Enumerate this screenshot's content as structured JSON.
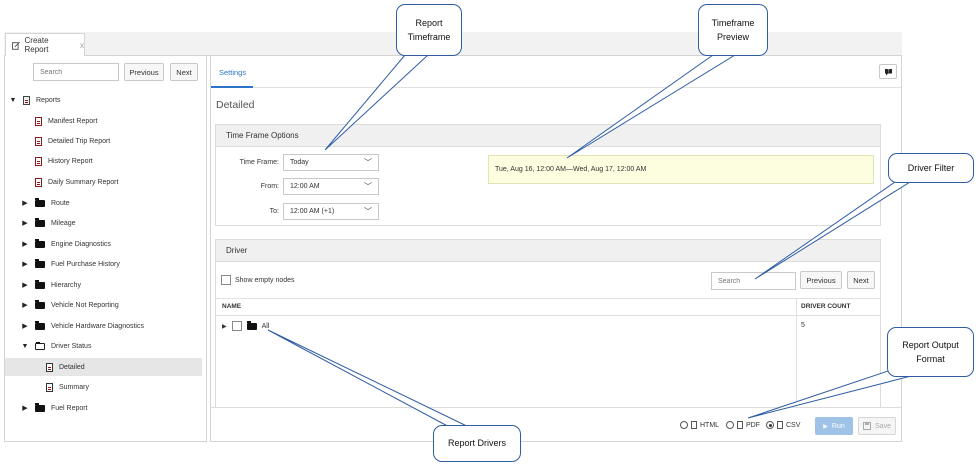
{
  "tab": {
    "label": "Create Report",
    "close": "x"
  },
  "left": {
    "search_placeholder": "Search",
    "previous": "Previous",
    "next": "Next",
    "tree": {
      "root": "Reports",
      "reports": [
        "Manifest Report",
        "Detailed Trip Report",
        "History Report",
        "Daily Summary Report"
      ],
      "folders": [
        "Route",
        "Mileage",
        "Engine Diagnostics",
        "Fuel Purchase History",
        "Hierarchy",
        "Vehicle Not Reporting",
        "Vehicle Hardware Diagnostics"
      ],
      "open_folder": "Driver Status",
      "open_children": [
        "Detailed",
        "Summary"
      ],
      "last_folder": "Fuel Report"
    }
  },
  "right": {
    "settings_tab": "Settings",
    "title": "Detailed",
    "timeframe": {
      "header": "Time Frame Options",
      "timeframe_label": "Time Frame:",
      "timeframe_value": "Today",
      "from_label": "From:",
      "from_value": "12:00 AM",
      "to_label": "To:",
      "to_value": "12:00 AM (+1)",
      "preview": "Tue, Aug 16, 12:00 AM—Wed, Aug 17, 12:00 AM"
    },
    "driver": {
      "header": "Driver",
      "show_empty": "Show empty nodes",
      "search_placeholder": "Search",
      "previous": "Previous",
      "next": "Next",
      "col_name": "NAME",
      "col_count": "DRIVER COUNT",
      "row_name": "All",
      "row_count": "5"
    },
    "footer": {
      "formats": [
        "HTML",
        "PDF",
        "CSV"
      ],
      "selected_format": "CSV",
      "run": "Run",
      "save": "Save"
    }
  },
  "callouts": {
    "report_timeframe": [
      "Report",
      "Timeframe"
    ],
    "timeframe_preview": [
      "Timeframe",
      "Preview"
    ],
    "driver_filter": "Driver Filter",
    "report_output_format": [
      "Report Output",
      "Format"
    ],
    "report_drivers": "Report Drivers"
  }
}
